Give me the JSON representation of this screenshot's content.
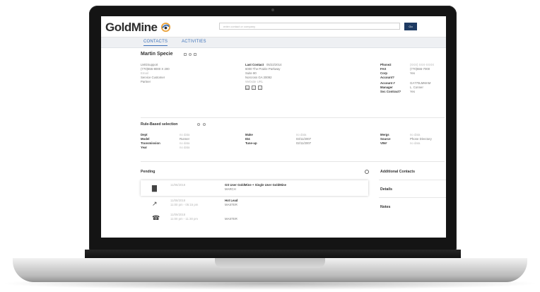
{
  "header": {
    "logo": "GoldMine",
    "search_placeholder": "enter contact or company",
    "go_label": "Go"
  },
  "tabs": [
    "CONTACTS",
    "ACTIVITIES"
  ],
  "contact": {
    "name": "Martin Specie",
    "info": [
      "LMGSupport",
      "(770)555-8000 X 200",
      "Email",
      "Service Customer",
      "Partner"
    ],
    "last_contact_label": "Last Contact",
    "last_contact_date": "05/22/2014",
    "address": [
      "6000 The Prairie Parkway",
      "Suite 80",
      "Norcross  GA  30092"
    ],
    "website": "Website URL",
    "social_icons": [
      "linkedin-icon",
      "facebook-icon",
      "twitter-icon"
    ],
    "right_fields": [
      {
        "label": "Phone2",
        "value": "(XXX) XXX-XXXX"
      },
      {
        "label": "FAX",
        "value": "(770)555-7000"
      },
      {
        "label": "Corp Account?",
        "value": "Yes"
      },
      {
        "label": "Account #",
        "value": "GA770LMMAM"
      },
      {
        "label": "Manager",
        "value": "L. Conner"
      },
      {
        "label": "Svc Contract?",
        "value": "Yes"
      }
    ]
  },
  "rule_section": {
    "title": "Rule-Based selection",
    "col1": [
      {
        "label": "Dept",
        "value": "no data"
      },
      {
        "label": "Model",
        "value": "Runner"
      },
      {
        "label": "Transmission",
        "value": "no data"
      },
      {
        "label": "Year",
        "value": "no data"
      }
    ],
    "col2": [
      {
        "label": "Make",
        "value": "no data"
      },
      {
        "label": "ID4",
        "value": "03/11/2007"
      },
      {
        "label": "Tune-up",
        "value": "02/11/2007"
      }
    ],
    "col3": [
      {
        "label": "Mergs",
        "value": "no data"
      },
      {
        "label": "Source",
        "value": "Phone Directory"
      },
      {
        "label": "VIN#",
        "value": "no data"
      }
    ]
  },
  "pending": {
    "title": "Pending",
    "items": [
      {
        "icon": "bar-chart-icon",
        "date": "11/06/2018",
        "time": "",
        "title": "GS User GoldMine + Single User GoldMine",
        "sub": "MARCH"
      },
      {
        "icon": "pin-icon",
        "date": "11/08/2018",
        "time": "11:00 pm - 05:15 pm",
        "title": "Hot Lead",
        "sub": "MASTER"
      },
      {
        "icon": "phone-icon",
        "date": "11/09/2018",
        "time": "11:00 pm - 11:30 pm",
        "title": "",
        "sub": "MASTER"
      }
    ]
  },
  "side_panels": [
    "Additional Contacts",
    "Details",
    "Notes"
  ],
  "colors": {
    "accent": "#3f73ba",
    "button": "#1e3b63"
  }
}
